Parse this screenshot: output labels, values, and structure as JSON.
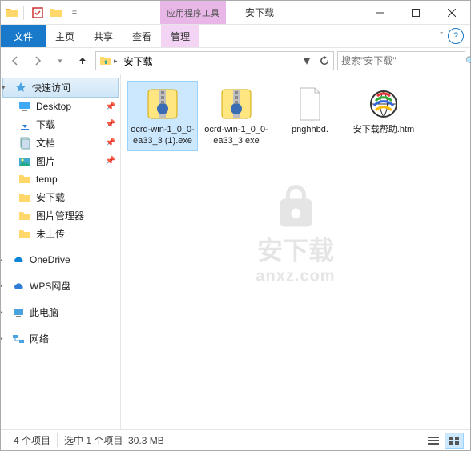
{
  "titlebar": {
    "context_tool_label": "应用程序工具",
    "window_title": "安下载"
  },
  "tabs": {
    "file": "文件",
    "home": "主页",
    "share": "共享",
    "view": "查看",
    "manage": "管理"
  },
  "nav": {
    "breadcrumb_root_icon": "download-folder",
    "breadcrumb_current": "安下载",
    "search_placeholder": "搜索\"安下载\""
  },
  "sidebar": {
    "quick_access": "快速访问",
    "items": [
      {
        "label": "Desktop",
        "pinned": true
      },
      {
        "label": "下载",
        "pinned": true
      },
      {
        "label": "文档",
        "pinned": true
      },
      {
        "label": "图片",
        "pinned": true
      },
      {
        "label": "temp",
        "pinned": false
      },
      {
        "label": "安下载",
        "pinned": false
      },
      {
        "label": "图片管理器",
        "pinned": false
      },
      {
        "label": "未上传",
        "pinned": false
      }
    ],
    "onedrive": "OneDrive",
    "wps": "WPS网盘",
    "this_pc": "此电脑",
    "network": "网络"
  },
  "files": [
    {
      "name": "ocrd-win-1_0_0-ea33_3 (1).exe",
      "type": "exe-archive",
      "selected": true
    },
    {
      "name": "ocrd-win-1_0_0-ea33_3.exe",
      "type": "exe-archive",
      "selected": false
    },
    {
      "name": "pnghhbd.",
      "type": "blank",
      "selected": false
    },
    {
      "name": "安下载帮助.htm",
      "type": "htm",
      "selected": false
    }
  ],
  "watermark": {
    "text1": "安下载",
    "text2": "anxz.com"
  },
  "status": {
    "count": "4 个项目",
    "selection": "选中 1 个项目",
    "size": "30.3 MB"
  }
}
